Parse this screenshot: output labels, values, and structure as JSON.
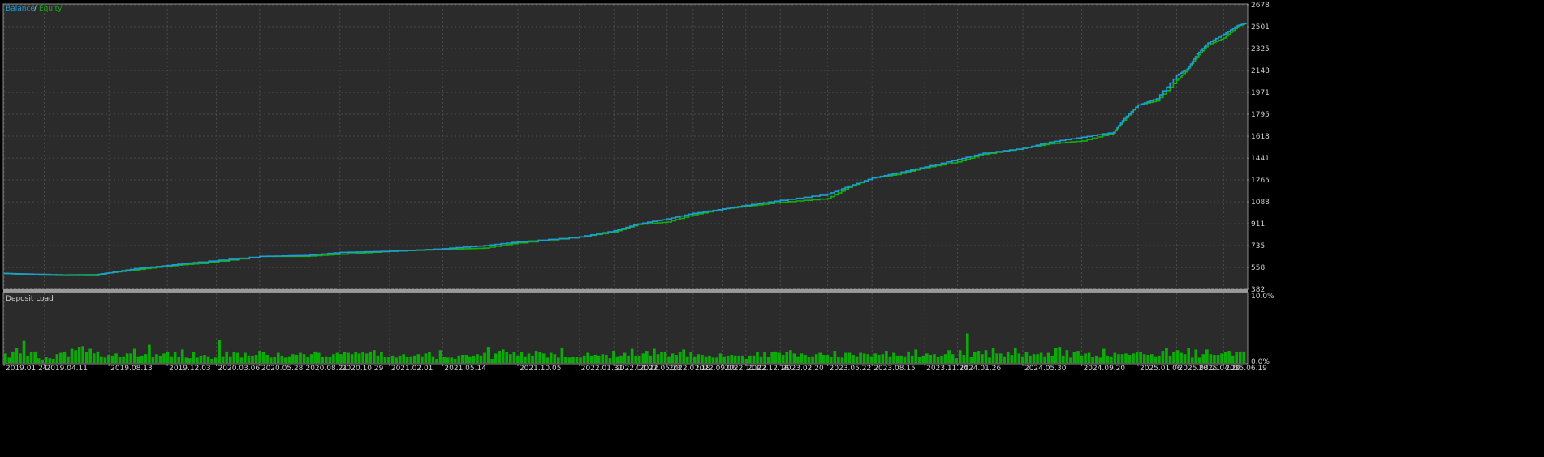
{
  "colors": {
    "background": "#000000",
    "panel": "#2b2b2b",
    "frame": "#8c8c8c",
    "grid": "#4a4a4a",
    "text": "#d0d0d0",
    "balance": "#1e9ed6",
    "equity": "#13b00f",
    "deposit_bar": "#0dab0a"
  },
  "chart_data": [
    {
      "type": "line",
      "legend": {
        "position": "top-left",
        "separator": "/"
      },
      "series": [
        {
          "name": "Balance",
          "color": "#1e9ed6"
        },
        {
          "name": "Equity",
          "color": "#13b00f"
        }
      ],
      "x_start": "2019.01.24",
      "x_end": "2025.08.01",
      "ylim": [
        382,
        2678
      ],
      "y_ticks": [
        2678,
        2501,
        2325,
        2148,
        1971,
        1795,
        1618,
        1441,
        1265,
        1088,
        911,
        735,
        558,
        382
      ],
      "grid": true,
      "balance_points": [
        [
          "2019.01.24",
          510
        ],
        [
          "2019.03.10",
          505
        ],
        [
          "2019.05.15",
          498
        ],
        [
          "2019.07.20",
          500
        ],
        [
          "2019.08.13",
          515
        ],
        [
          "2019.10.01",
          548
        ],
        [
          "2019.12.03",
          575
        ],
        [
          "2020.02.01",
          602
        ],
        [
          "2020.05.28",
          648
        ],
        [
          "2020.08.21",
          655
        ],
        [
          "2020.10.29",
          680
        ],
        [
          "2021.02.01",
          690
        ],
        [
          "2021.05.14",
          710
        ],
        [
          "2021.08.01",
          735
        ],
        [
          "2021.10.05",
          765
        ],
        [
          "2022.01.31",
          805
        ],
        [
          "2022.04.07",
          855
        ],
        [
          "2022.05.23",
          910
        ],
        [
          "2022.07.18",
          950
        ],
        [
          "2022.09.06",
          995
        ],
        [
          "2022.11.02",
          1030
        ],
        [
          "2022.12.16",
          1060
        ],
        [
          "2023.02.20",
          1100
        ],
        [
          "2023.05.22",
          1150
        ],
        [
          "2023.07.01",
          1215
        ],
        [
          "2023.08.15",
          1280
        ],
        [
          "2023.10.01",
          1320
        ],
        [
          "2023.11.24",
          1370
        ],
        [
          "2024.01.26",
          1430
        ],
        [
          "2024.03.15",
          1480
        ],
        [
          "2024.05.30",
          1520
        ],
        [
          "2024.07.20",
          1570
        ],
        [
          "2024.09.20",
          1610
        ],
        [
          "2024.11.20",
          1650
        ],
        [
          "2024.12.10",
          1760
        ],
        [
          "2025.01.06",
          1870
        ],
        [
          "2025.02.10",
          1920
        ],
        [
          "2025.03.21",
          2110
        ],
        [
          "2025.04.10",
          2160
        ],
        [
          "2025.04.29",
          2280
        ],
        [
          "2025.05.20",
          2370
        ],
        [
          "2025.06.19",
          2440
        ],
        [
          "2025.07.15",
          2510
        ],
        [
          "2025.08.01",
          2530
        ]
      ],
      "equity_offsets": [
        0,
        -6,
        -4,
        -8,
        0,
        -10,
        -5,
        -12,
        0,
        -7,
        -15,
        0,
        -6,
        -20,
        -8,
        0,
        -10,
        -5,
        -25,
        -12,
        0,
        -8,
        -15,
        -35,
        -10,
        0,
        -12,
        -6,
        -20,
        -9,
        0,
        -14,
        -30,
        -5,
        -12,
        0,
        -18,
        -40,
        -10,
        -22,
        -15,
        -30,
        -8,
        0
      ],
      "x_tick_labels": [
        "2019.01.24",
        "2019.04.11",
        "2019.08.13",
        "2019.12.03",
        "2020.03.06",
        "2020.05.28",
        "2020.08.21",
        "2020.10.29",
        "2021.02.01",
        "2021.05.14",
        "2021.10.05",
        "2022.01.31",
        "2022.04.07",
        "2022.05.23",
        "2022.07.18",
        "2022.09.06",
        "2022.11.02",
        "2022.12.16",
        "2023.02.20",
        "2023.05.22",
        "2023.08.15",
        "2023.11.24",
        "2024.01.26",
        "2024.05.30",
        "2024.09.20",
        "2025.01.06",
        "2025.03.21",
        "2025.04.29",
        "2025.06.19"
      ]
    },
    {
      "type": "bar",
      "title": "Deposit Load",
      "ylim": [
        0,
        10
      ],
      "y_ticks": [
        "10.0%",
        "0.0%"
      ],
      "bar_count": 330,
      "values_percent": [
        1.4,
        0.8,
        1.7,
        2.2,
        1.4,
        3.3,
        1.1,
        1.6,
        1.7,
        0.7,
        0.5,
        0.9,
        0.7,
        0.6,
        1.3,
        1.5,
        1.7,
        1.0,
        2.1,
        1.9,
        2.4,
        2.5,
        1.6,
        2.1,
        1.4,
        1.7,
        1.0,
        0.8,
        1.2,
        1.1,
        1.4,
        0.9,
        1.0,
        1.4,
        1.4,
        2.1,
        1.0,
        1.1,
        1.3,
        2.7,
        0.9,
        1.3,
        1.1,
        1.4,
        1.6,
        1.0,
        1.6,
        0.9,
        2.0,
        0.8,
        0.7,
        1.6,
        0.8,
        1.1,
        1.2,
        1.0,
        0.6,
        0.8,
        3.4,
        1.0,
        1.7,
        1.0,
        1.6,
        1.5,
        0.8,
        1.5,
        1.1,
        1.1,
        1.2,
        1.8,
        1.6,
        1.2,
        0.8,
        0.9,
        1.5,
        1.1,
        0.8,
        1.0,
        1.3,
        1.2,
        1.5,
        1.3,
        0.9,
        1.3,
        1.7,
        1.5,
        0.9,
        1.0,
        0.9,
        1.3,
        1.5,
        1.3,
        1.6,
        1.5,
        1.3,
        1.6,
        1.4,
        1.6,
        1.4,
        1.7,
        1.9,
        1.1,
        1.6,
        0.9,
        0.9,
        1.1,
        0.8,
        1.1,
        1.3,
        0.9,
        1.0,
        1.1,
        1.3,
        1.0,
        1.4,
        1.6,
        1.0,
        0.6,
        1.9,
        0.9,
        0.8,
        0.8,
        0.6,
        1.1,
        1.2,
        1.2,
        1.0,
        1.1,
        1.3,
        1.1,
        1.5,
        2.4,
        0.6,
        1.4,
        1.8,
        2.0,
        1.6,
        1.3,
        1.6,
        1.1,
        1.6,
        1.0,
        1.4,
        1.1,
        1.8,
        1.6,
        1.4,
        0.8,
        1.5,
        1.3,
        0.8,
        2.3,
        0.9,
        0.8,
        0.9,
        0.9,
        0.8,
        1.1,
        1.5,
        1.1,
        1.2,
        1.1,
        1.3,
        1.2,
        0.7,
        1.8,
        1.0,
        1.1,
        1.5,
        1.1,
        2.1,
        1.1,
        1.1,
        1.4,
        1.8,
        1.1,
        2.1,
        1.3,
        1.6,
        1.7,
        1.0,
        1.4,
        1.2,
        1.6,
        2.0,
        1.0,
        1.6,
        1.0,
        1.3,
        1.2,
        1.0,
        1.1,
        0.8,
        0.8,
        1.4,
        1.0,
        1.1,
        1.2,
        1.1,
        1.1,
        1.1,
        0.6,
        1.1,
        1.1,
        1.6,
        1.0,
        1.6,
        0.9,
        1.6,
        1.7,
        1.5,
        1.2,
        1.6,
        1.9,
        1.4,
        1.0,
        1.4,
        1.2,
        0.9,
        1.0,
        1.3,
        1.5,
        1.2,
        1.2,
        0.9,
        1.8,
        0.9,
        0.8,
        1.5,
        1.5,
        1.2,
        1.0,
        1.5,
        1.4,
        1.3,
        1.0,
        1.4,
        1.2,
        1.3,
        1.8,
        1.0,
        1.5,
        1.1,
        1.1,
        1.0,
        1.7,
        1.1,
        2.0,
        0.9,
        1.1,
        1.4,
        1.2,
        1.3,
        0.9,
        1.1,
        1.3,
        1.9,
        1.3,
        0.7,
        1.9,
        1.2,
        4.4,
        0.9,
        1.6,
        1.8,
        1.3,
        1.9,
        0.8,
        2.2,
        1.4,
        1.4,
        1.0,
        1.6,
        1.2,
        2.3,
        1.4,
        1.0,
        1.6,
        1.1,
        1.3,
        1.3,
        1.5,
        1.0,
        1.5,
        1.1,
        2.2,
        2.4,
        1.1,
        1.9,
        0.8,
        1.6,
        1.8,
        1.1,
        1.4,
        1.5,
        0.9,
        1.1,
        0.8,
        2.1,
        1.1,
        1.0,
        1.5,
        1.3,
        1.3,
        1.4,
        1.2,
        1.4,
        1.6,
        1.6,
        1.3,
        1.2,
        1.3,
        1.0,
        1.1,
        1.8,
        2.3,
        1.1,
        1.6,
        1.9,
        1.5,
        1.3,
        2.2,
        0.8,
        2.0,
        0.8,
        1.3,
        2.0,
        1.3,
        1.2,
        1.2,
        1.4,
        1.6,
        1.8,
        1.1,
        1.6,
        1.7,
        1.7
      ]
    }
  ]
}
